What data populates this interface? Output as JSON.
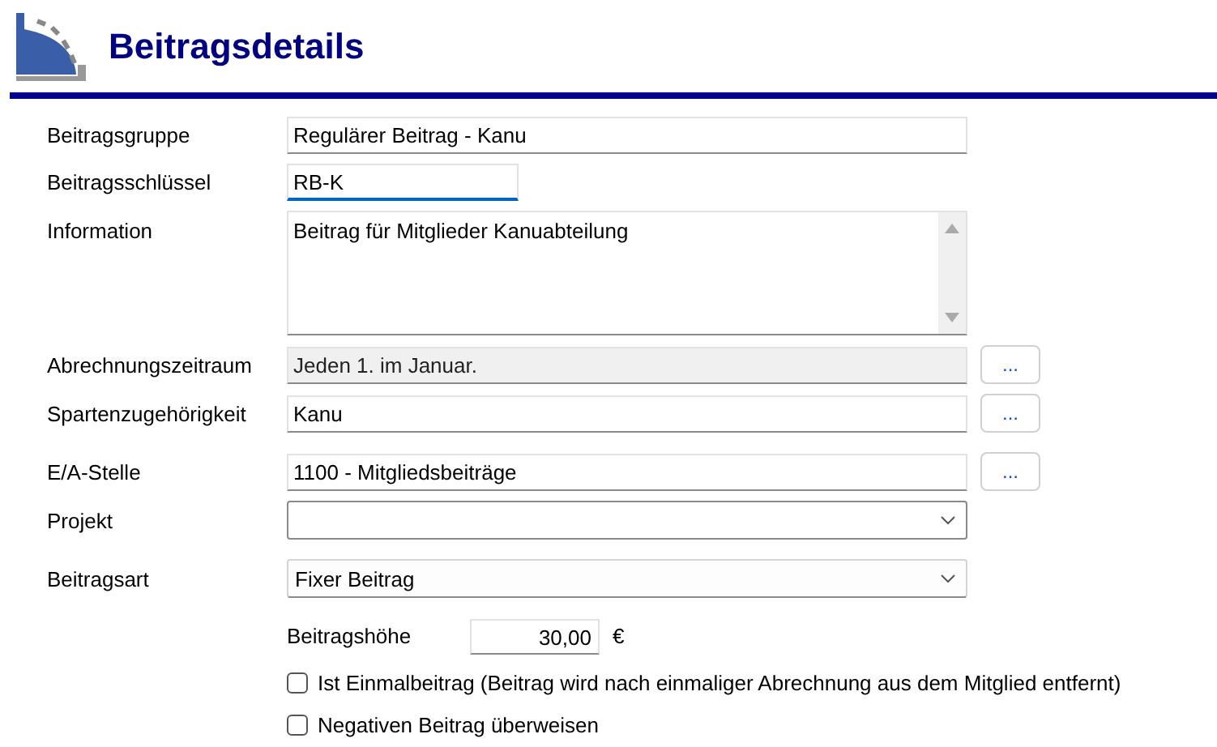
{
  "header": {
    "title": "Beitragsdetails"
  },
  "sections": [
    {
      "fields": [
        {
          "kind": "text",
          "label": "Beitragsgruppe",
          "value": "Regulärer Beitrag - Kanu",
          "readonly": false,
          "focused": false
        },
        {
          "kind": "short_text",
          "label": "Beitragsschlüssel",
          "value": "RB-K",
          "readonly": false,
          "focused": true
        },
        {
          "kind": "textarea",
          "label": "Information",
          "value": "Beitrag für Mitglieder Kanuabteilung"
        },
        {
          "kind": "text",
          "label": "Abrechnungszeitraum",
          "value": "Jeden 1. im Januar.",
          "readonly": true,
          "focused": false,
          "button": "..."
        },
        {
          "kind": "text",
          "label": "Spartenzugehörigkeit",
          "value": "Kanu",
          "readonly": false,
          "focused": false,
          "button": "..."
        }
      ]
    },
    {
      "fields": [
        {
          "kind": "text",
          "label": "E/A-Stelle",
          "value": "1100 - Mitgliedsbeiträge",
          "readonly": false,
          "focused": false,
          "button": "..."
        },
        {
          "kind": "select",
          "label": "Projekt"
        }
      ]
    },
    {
      "fields": [
        {
          "kind": "select",
          "label": "Beitragsart",
          "value": "Fixer Beitrag"
        }
      ]
    }
  ],
  "amount": {
    "label": "Beitragshöhe",
    "value": "30,00",
    "unit": "€"
  },
  "checkboxes": [
    {
      "label": "Ist Einmalbeitrag (Beitrag wird nach einmaliger Abrechnung aus dem Mitglied entfernt)",
      "checked": false
    },
    {
      "label": "Negativen Beitrag überweisen",
      "checked": false
    }
  ]
}
